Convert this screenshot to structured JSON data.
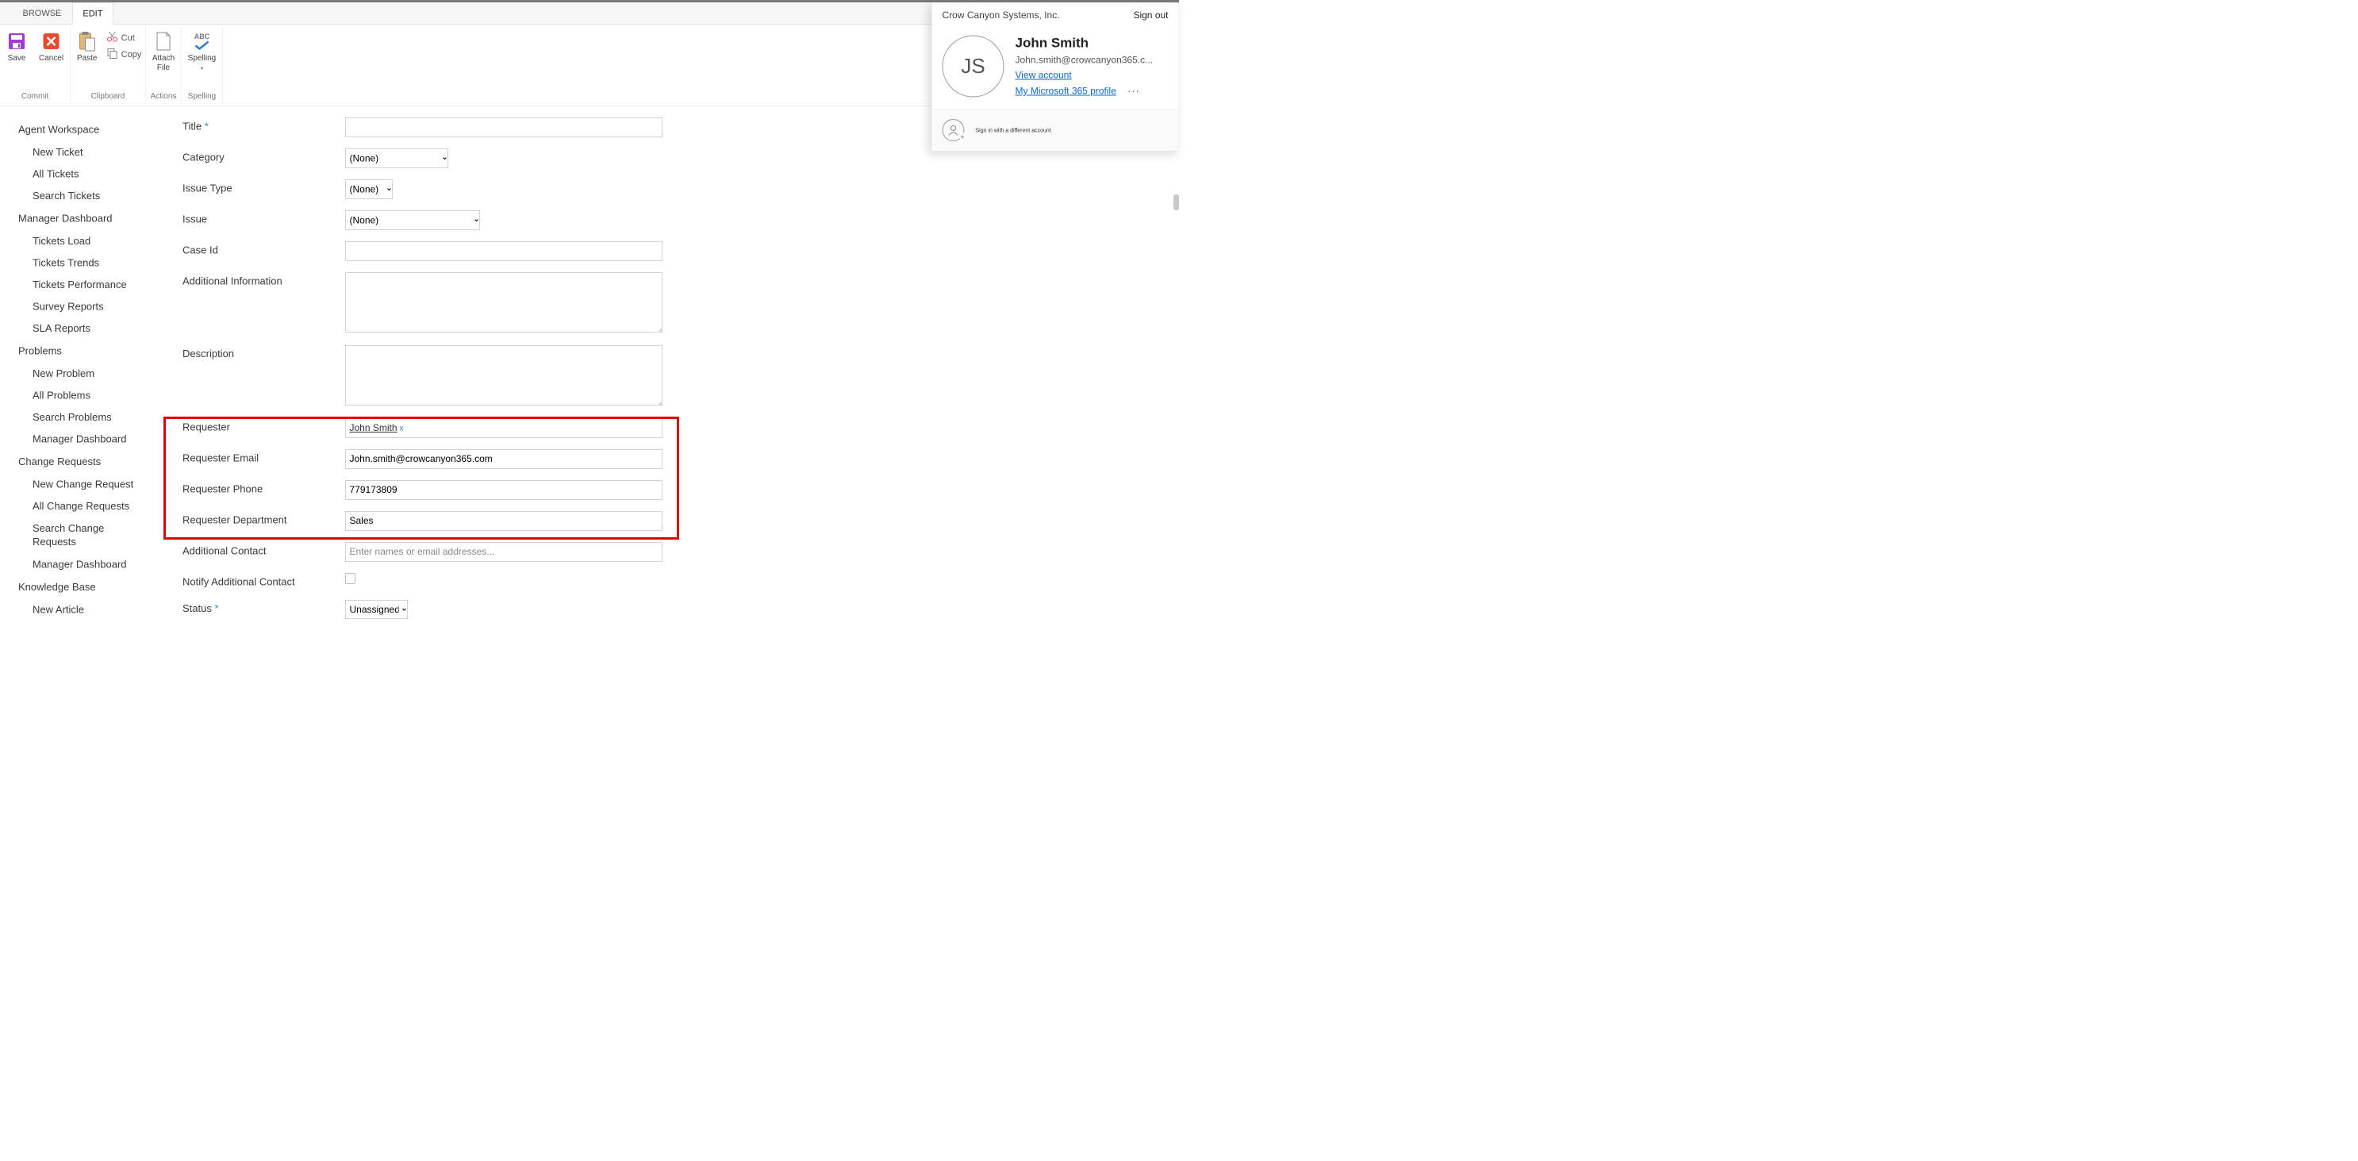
{
  "tabs": {
    "browse": "BROWSE",
    "edit": "EDIT",
    "active": "edit"
  },
  "ribbon": {
    "commit": {
      "label": "Commit",
      "save": "Save",
      "cancel": "Cancel"
    },
    "clipboard": {
      "label": "Clipboard",
      "paste": "Paste",
      "cut": "Cut",
      "copy": "Copy"
    },
    "actions": {
      "label": "Actions",
      "attach": "Attach\nFile"
    },
    "spelling": {
      "label": "Spelling",
      "spelling": "Spelling"
    }
  },
  "sidebar": {
    "agent": {
      "title": "Agent Workspace",
      "items": [
        "New Ticket",
        "All Tickets",
        "Search Tickets"
      ]
    },
    "manager": {
      "title": "Manager Dashboard",
      "items": [
        "Tickets Load",
        "Tickets Trends",
        "Tickets Performance",
        "Survey Reports",
        "SLA Reports"
      ]
    },
    "problems": {
      "title": "Problems",
      "items": [
        "New Problem",
        "All Problems",
        "Search Problems",
        "Manager Dashboard"
      ]
    },
    "changes": {
      "title": "Change Requests",
      "items": [
        "New Change Request",
        "All Change Requests",
        "Search Change Requests",
        "Manager Dashboard"
      ]
    },
    "kb": {
      "title": "Knowledge Base",
      "items": [
        "New Article"
      ]
    }
  },
  "form": {
    "title_label": "Title",
    "title_value": "",
    "category_label": "Category",
    "category_value": "(None)",
    "issue_type_label": "Issue Type",
    "issue_type_value": "(None)",
    "issue_label": "Issue",
    "issue_value": "(None)",
    "case_id_label": "Case Id",
    "case_id_value": "",
    "addinfo_label": "Additional Information",
    "addinfo_value": "",
    "description_label": "Description",
    "description_value": "",
    "requester_label": "Requester",
    "requester_value": "John Smith",
    "req_email_label": "Requester Email",
    "req_email_value": "John.smith@crowcanyon365.com",
    "req_phone_label": "Requester Phone",
    "req_phone_value": "779173809",
    "req_dept_label": "Requester Department",
    "req_dept_value": "Sales",
    "add_contact_label": "Additional Contact",
    "add_contact_placeholder": "Enter names or email addresses...",
    "notify_label": "Notify Additional Contact",
    "status_label": "Status",
    "status_value": "Unassigned"
  },
  "flyout": {
    "org": "Crow Canyon Systems, Inc.",
    "signout": "Sign out",
    "initials": "JS",
    "name": "John Smith",
    "email": "John.smith@crowcanyon365.c...",
    "view_account": "View account",
    "my_profile": "My Microsoft 365 profile",
    "alt_signin": "Sign in with a different account"
  }
}
